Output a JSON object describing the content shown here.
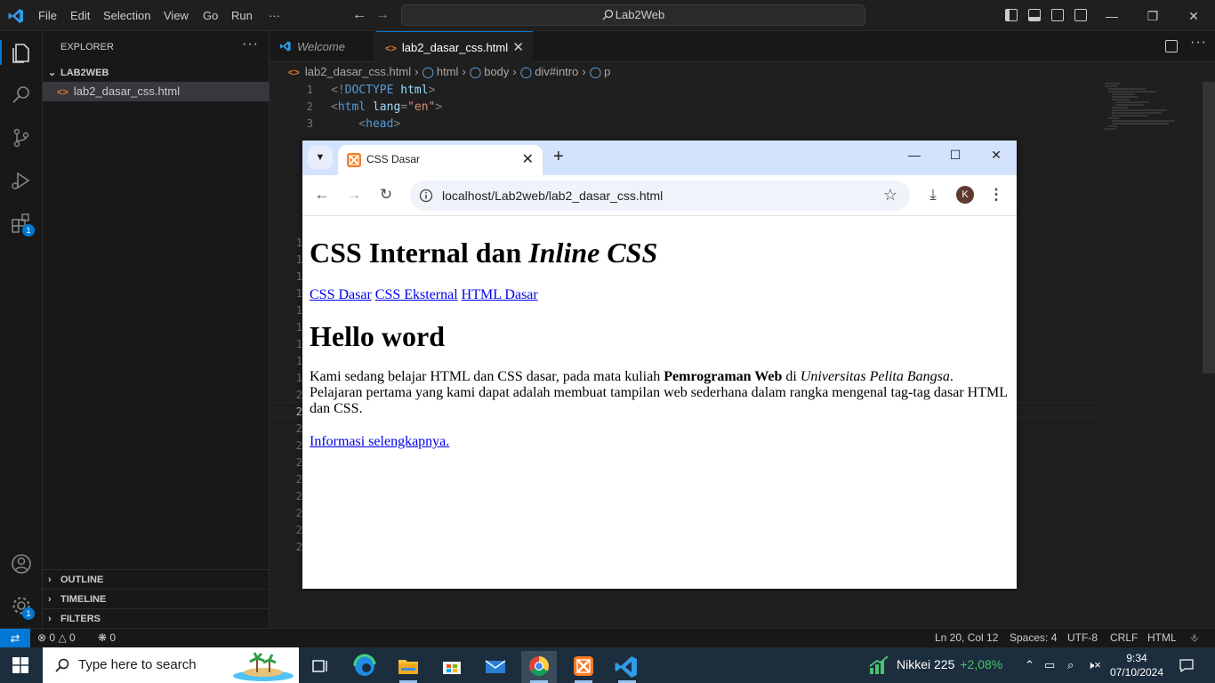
{
  "vscode": {
    "menu": [
      "File",
      "Edit",
      "Selection",
      "View",
      "Go",
      "Run"
    ],
    "menu_more": "···",
    "search": "Lab2Web",
    "explorer_title": "EXPLORER",
    "explorer_more": "···",
    "folder_name": "LAB2WEB",
    "file_name": "lab2_dasar_css.html",
    "sections": [
      "OUTLINE",
      "TIMELINE",
      "FILTERS"
    ],
    "extensions_badge": "1",
    "settings_badge": "1",
    "tabs": [
      {
        "label": "Welcome",
        "active": false
      },
      {
        "label": "lab2_dasar_css.html",
        "active": true
      }
    ],
    "breadcrumb": [
      "lab2_dasar_css.html",
      "html",
      "body",
      "div#intro",
      "p"
    ],
    "code_lines": [
      {
        "n": "1",
        "parts": [
          [
            "tag-b",
            "<!"
          ],
          [
            "tag-n",
            "DOCTYPE"
          ],
          [
            "attr",
            " html"
          ],
          [
            "tag-b",
            ">"
          ]
        ]
      },
      {
        "n": "2",
        "parts": [
          [
            "tag-b",
            "<"
          ],
          [
            "tag-n",
            "html"
          ],
          [
            "attr",
            " lang"
          ],
          [
            "tag-b",
            "="
          ],
          [
            "str",
            "\"en\""
          ],
          [
            "tag-b",
            ">"
          ]
        ]
      },
      {
        "n": "3",
        "parts": [
          [
            "tag-b",
            "    <"
          ],
          [
            "tag-n",
            "head"
          ],
          [
            "tag-b",
            ">"
          ]
        ]
      }
    ],
    "hidden_line_numbers": [
      "1",
      "1",
      "1",
      "1",
      "1",
      "1",
      "1",
      "1",
      "1",
      "2",
      "2",
      "2",
      "2",
      "2",
      "2",
      "2",
      "2",
      "2",
      "2"
    ],
    "status": {
      "errors": "0",
      "warnings": "0",
      "ports": "0",
      "position": "Ln 20, Col 12",
      "spaces": "Spaces: 4",
      "encoding": "UTF-8",
      "eol": "CRLF",
      "language": "HTML"
    }
  },
  "chrome": {
    "tab_title": "CSS Dasar",
    "url": "localhost/Lab2web/lab2_dasar_css.html",
    "profile_initial": "K"
  },
  "page": {
    "h1_plain": "CSS Internal dan ",
    "h1_italic": "Inline CSS",
    "nav_links": [
      "CSS Dasar",
      "CSS Eksternal",
      "HTML Dasar"
    ],
    "h2": "Hello word",
    "para_1": "Kami sedang belajar HTML dan CSS dasar, pada mata kuliah ",
    "para_bold": "Pemrograman Web",
    "para_2": " di ",
    "para_italic": "Universitas Pelita Bangsa",
    "para_3": ". Pelajaran pertama yang kami dapat adalah membuat tampilan web sederhana dalam rangka mengenal tag-tag dasar HTML dan CSS.",
    "more_link": "Informasi selengkapnya."
  },
  "taskbar": {
    "search_placeholder": "Type here to search",
    "stock_name": "Nikkei 225",
    "stock_change": "+2,08%",
    "time": "9:34",
    "date": "07/10/2024"
  },
  "colors": {
    "accent": "#0078d4",
    "link": "#0000ee",
    "chrome_tabstrip": "#d3e3fd",
    "stock_up": "#46c46f"
  }
}
